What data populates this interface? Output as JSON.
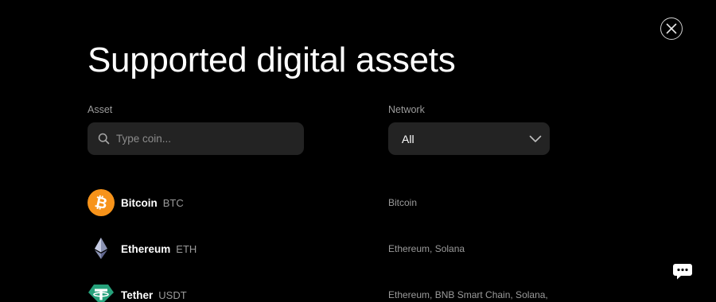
{
  "page": {
    "title": "Supported digital assets"
  },
  "filters": {
    "asset_label": "Asset",
    "asset_placeholder": "Type coin...",
    "asset_value": "",
    "network_label": "Network",
    "network_value": "All"
  },
  "assets": [
    {
      "name": "Bitcoin",
      "symbol": "BTC",
      "networks": "Bitcoin",
      "icon": "bitcoin-icon",
      "color": "#F7931A"
    },
    {
      "name": "Ethereum",
      "symbol": "ETH",
      "networks": "Ethereum, Solana",
      "icon": "ethereum-icon",
      "color": "#627EEA"
    },
    {
      "name": "Tether",
      "symbol": "USDT",
      "networks": "Ethereum, BNB Smart Chain, Solana,",
      "icon": "tether-icon",
      "color": "#26A17B"
    }
  ],
  "icons": {
    "close": "close-icon",
    "search": "search-icon",
    "dropdown": "chevron-down-icon",
    "chat": "chat-icon"
  },
  "colors": {
    "background": "#000000",
    "input_background": "#232323",
    "muted_text": "#9b9b9b"
  }
}
